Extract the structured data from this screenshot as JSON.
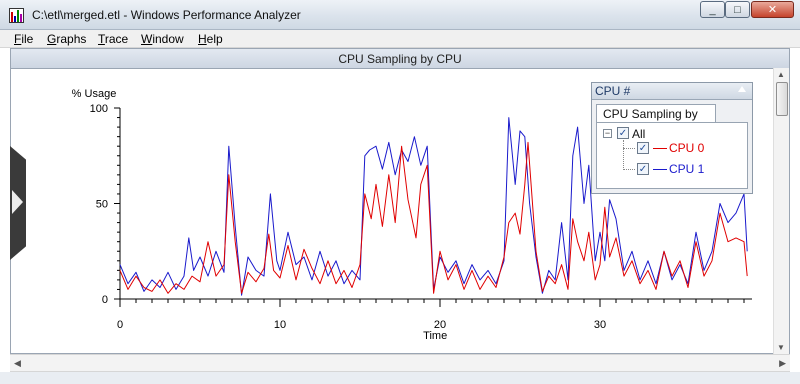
{
  "window": {
    "title": "C:\\etl\\merged.etl - Windows Performance Analyzer",
    "minimize_glyph": "_",
    "maximize_glyph": "□",
    "close_glyph": "✕"
  },
  "menu": {
    "file_first": "F",
    "file_rest": "ile",
    "graphs_first": "G",
    "graphs_rest": "raphs",
    "trace_first": "T",
    "trace_rest": "race",
    "window_first": "W",
    "window_rest": "indow",
    "help_first": "H",
    "help_rest": "elp"
  },
  "graph": {
    "header_title": "CPU Sampling by CPU"
  },
  "legend_panel": {
    "header": "CPU #",
    "tab_label": "CPU Sampling by CPU",
    "all_label": "All",
    "collapse_glyph": "−",
    "check_glyph": "✓"
  },
  "colors": {
    "cpu0": "#e00000",
    "cpu1": "#1a1acc"
  },
  "chart_data": {
    "type": "line",
    "title": "",
    "xlabel": "Time",
    "ylabel": "% Usage",
    "xlim": [
      0,
      39.5
    ],
    "ylim": [
      0,
      100
    ],
    "x_ticks": [
      0,
      10,
      20,
      30
    ],
    "y_ticks": [
      0,
      50,
      100
    ],
    "grid": false,
    "legend_position": "top-right",
    "series": [
      {
        "name": "CPU 0",
        "color": "#e00000",
        "points": [
          [
            0,
            15
          ],
          [
            0.5,
            5
          ],
          [
            1,
            12
          ],
          [
            1.5,
            6
          ],
          [
            2,
            4
          ],
          [
            2.5,
            10
          ],
          [
            3,
            3
          ],
          [
            3.5,
            8
          ],
          [
            4,
            5
          ],
          [
            4.5,
            12
          ],
          [
            5,
            9
          ],
          [
            5.5,
            30
          ],
          [
            6,
            12
          ],
          [
            6.5,
            18
          ],
          [
            6.8,
            65
          ],
          [
            7.2,
            30
          ],
          [
            7.6,
            3
          ],
          [
            8,
            14
          ],
          [
            8.5,
            9
          ],
          [
            9,
            16
          ],
          [
            9.3,
            34
          ],
          [
            9.6,
            15
          ],
          [
            10,
            11
          ],
          [
            10.5,
            28
          ],
          [
            11,
            10
          ],
          [
            11.5,
            26
          ],
          [
            12,
            16
          ],
          [
            12.5,
            8
          ],
          [
            13,
            20
          ],
          [
            13.5,
            8
          ],
          [
            14,
            15
          ],
          [
            14.5,
            6
          ],
          [
            15,
            18
          ],
          [
            15.3,
            55
          ],
          [
            15.7,
            42
          ],
          [
            16,
            60
          ],
          [
            16.4,
            38
          ],
          [
            16.8,
            65
          ],
          [
            17.2,
            40
          ],
          [
            17.6,
            80
          ],
          [
            18,
            52
          ],
          [
            18.5,
            32
          ],
          [
            18.8,
            60
          ],
          [
            19.2,
            70
          ],
          [
            19.6,
            3
          ],
          [
            20,
            25
          ],
          [
            20.5,
            10
          ],
          [
            21,
            18
          ],
          [
            21.5,
            5
          ],
          [
            22,
            15
          ],
          [
            22.5,
            5
          ],
          [
            23,
            12
          ],
          [
            23.5,
            6
          ],
          [
            24,
            22
          ],
          [
            24.3,
            40
          ],
          [
            24.7,
            45
          ],
          [
            25,
            34
          ],
          [
            25.3,
            60
          ],
          [
            25.5,
            82
          ],
          [
            26,
            25
          ],
          [
            26.4,
            4
          ],
          [
            26.8,
            12
          ],
          [
            27.2,
            8
          ],
          [
            27.6,
            18
          ],
          [
            28,
            5
          ],
          [
            28.3,
            42
          ],
          [
            28.6,
            30
          ],
          [
            29,
            20
          ],
          [
            29.3,
            35
          ],
          [
            29.7,
            10
          ],
          [
            30,
            18
          ],
          [
            30.3,
            48
          ],
          [
            30.6,
            22
          ],
          [
            31,
            32
          ],
          [
            31.5,
            12
          ],
          [
            32,
            20
          ],
          [
            32.5,
            8
          ],
          [
            33,
            15
          ],
          [
            33.5,
            5
          ],
          [
            34,
            25
          ],
          [
            34.5,
            12
          ],
          [
            35,
            20
          ],
          [
            35.5,
            6
          ],
          [
            36,
            30
          ],
          [
            36.5,
            12
          ],
          [
            37,
            20
          ],
          [
            37.5,
            45
          ],
          [
            38,
            30
          ],
          [
            38.5,
            32
          ],
          [
            39,
            30
          ],
          [
            39.2,
            12
          ]
        ]
      },
      {
        "name": "CPU 1",
        "color": "#1a1acc",
        "points": [
          [
            0,
            18
          ],
          [
            0.5,
            8
          ],
          [
            1,
            14
          ],
          [
            1.5,
            4
          ],
          [
            2,
            10
          ],
          [
            2.5,
            6
          ],
          [
            3,
            14
          ],
          [
            3.5,
            5
          ],
          [
            4,
            12
          ],
          [
            4.3,
            32
          ],
          [
            4.6,
            15
          ],
          [
            5,
            22
          ],
          [
            5.5,
            12
          ],
          [
            6,
            25
          ],
          [
            6.5,
            14
          ],
          [
            6.8,
            80
          ],
          [
            7.2,
            38
          ],
          [
            7.6,
            2
          ],
          [
            8,
            22
          ],
          [
            8.5,
            15
          ],
          [
            9,
            12
          ],
          [
            9.4,
            55
          ],
          [
            9.8,
            20
          ],
          [
            10,
            15
          ],
          [
            10.5,
            35
          ],
          [
            11,
            18
          ],
          [
            11.5,
            22
          ],
          [
            12,
            10
          ],
          [
            12.5,
            25
          ],
          [
            13,
            12
          ],
          [
            13.5,
            20
          ],
          [
            14,
            8
          ],
          [
            14.5,
            15
          ],
          [
            15,
            10
          ],
          [
            15.3,
            75
          ],
          [
            15.6,
            78
          ],
          [
            16,
            80
          ],
          [
            16.4,
            68
          ],
          [
            16.8,
            82
          ],
          [
            17.2,
            65
          ],
          [
            17.6,
            78
          ],
          [
            18,
            72
          ],
          [
            18.4,
            85
          ],
          [
            18.8,
            70
          ],
          [
            19.2,
            80
          ],
          [
            19.6,
            5
          ],
          [
            20,
            22
          ],
          [
            20.5,
            14
          ],
          [
            21,
            20
          ],
          [
            21.5,
            8
          ],
          [
            22,
            18
          ],
          [
            22.5,
            10
          ],
          [
            23,
            15
          ],
          [
            23.5,
            8
          ],
          [
            24,
            20
          ],
          [
            24.3,
            95
          ],
          [
            24.7,
            60
          ],
          [
            25,
            88
          ],
          [
            25.3,
            85
          ],
          [
            25.6,
            50
          ],
          [
            26,
            22
          ],
          [
            26.4,
            3
          ],
          [
            26.8,
            15
          ],
          [
            27.2,
            10
          ],
          [
            27.6,
            40
          ],
          [
            28,
            10
          ],
          [
            28.3,
            75
          ],
          [
            28.6,
            90
          ],
          [
            29,
            50
          ],
          [
            29.3,
            70
          ],
          [
            29.7,
            20
          ],
          [
            30,
            35
          ],
          [
            30.3,
            20
          ],
          [
            30.6,
            52
          ],
          [
            31,
            42
          ],
          [
            31.5,
            15
          ],
          [
            32,
            25
          ],
          [
            32.5,
            10
          ],
          [
            33,
            20
          ],
          [
            33.5,
            8
          ],
          [
            34,
            25
          ],
          [
            34.5,
            10
          ],
          [
            35,
            18
          ],
          [
            35.5,
            8
          ],
          [
            36,
            35
          ],
          [
            36.5,
            15
          ],
          [
            37,
            25
          ],
          [
            37.5,
            50
          ],
          [
            38,
            40
          ],
          [
            38.5,
            45
          ],
          [
            39,
            55
          ],
          [
            39.2,
            25
          ]
        ]
      }
    ]
  }
}
